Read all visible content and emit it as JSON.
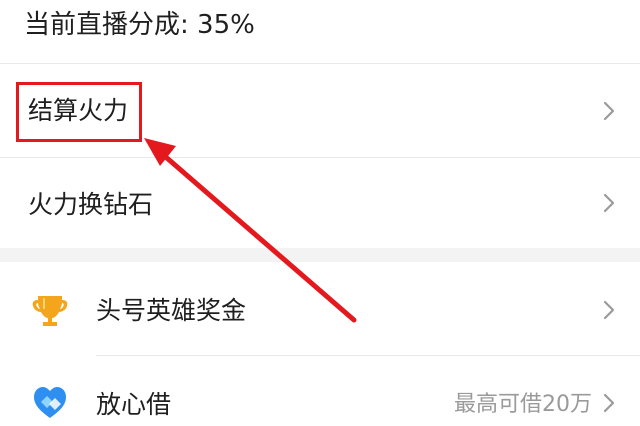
{
  "header": {
    "commission_text": "当前直播分成: 35%"
  },
  "menu": {
    "settle_firepower": "结算火力",
    "firepower_to_diamond": "火力换钻石",
    "hero_bonus": "头号英雄奖金",
    "fangxin_loan": "放心借",
    "fangxin_loan_value": "最高可借20万"
  },
  "colors": {
    "highlight": "#e3191e",
    "chevron": "#9a9a9a",
    "trophy": "#f3a51d",
    "loan_icon": "#2f8ff0"
  },
  "icons": {
    "chevron": "chevron-right-icon",
    "trophy": "trophy-icon",
    "loan": "loan-icon"
  }
}
